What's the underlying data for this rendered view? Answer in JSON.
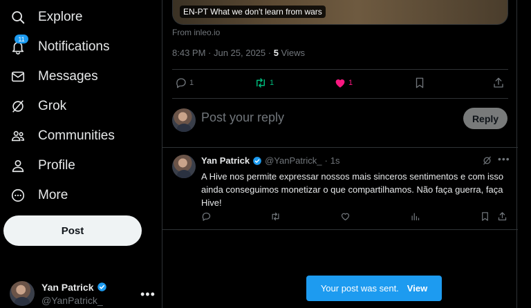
{
  "nav": {
    "items": [
      {
        "label": "Explore",
        "icon": "search-icon"
      },
      {
        "label": "Notifications",
        "icon": "bell-icon",
        "badge": "11"
      },
      {
        "label": "Messages",
        "icon": "envelope-icon"
      },
      {
        "label": "Grok",
        "icon": "grok-icon"
      },
      {
        "label": "Communities",
        "icon": "people-icon"
      },
      {
        "label": "Profile",
        "icon": "person-icon"
      },
      {
        "label": "More",
        "icon": "more-circle-icon"
      }
    ],
    "post_label": "Post",
    "account": {
      "name": "Yan Patrick",
      "handle": "@YanPatrick_"
    }
  },
  "focused_post": {
    "media_label": "EN-PT What we don't learn from wars",
    "source": "From inleo.io",
    "time": "8:43 PM · Jun 25, 2025 · ",
    "views_count": "5",
    "views_label": " Views",
    "reply_count": "1",
    "repost_count": "1",
    "like_count": "1"
  },
  "reply_box": {
    "placeholder": "Post your reply",
    "button": "Reply"
  },
  "reply_tweet": {
    "name": "Yan Patrick",
    "handle": "@YanPatrick_",
    "dot": "·",
    "time": "1s",
    "text": "A Hive nos permite expressar nossos mais sinceros sentimentos e com isso ainda conseguimos monetizar o que compartilhamos. Não faça guerra, faça Hive!"
  },
  "toast": {
    "message": "Your post was sent.",
    "action": "View"
  },
  "colors": {
    "accent": "#1d9bf0",
    "like": "#f91880",
    "repost": "#00ba7c",
    "muted": "#71767b"
  }
}
